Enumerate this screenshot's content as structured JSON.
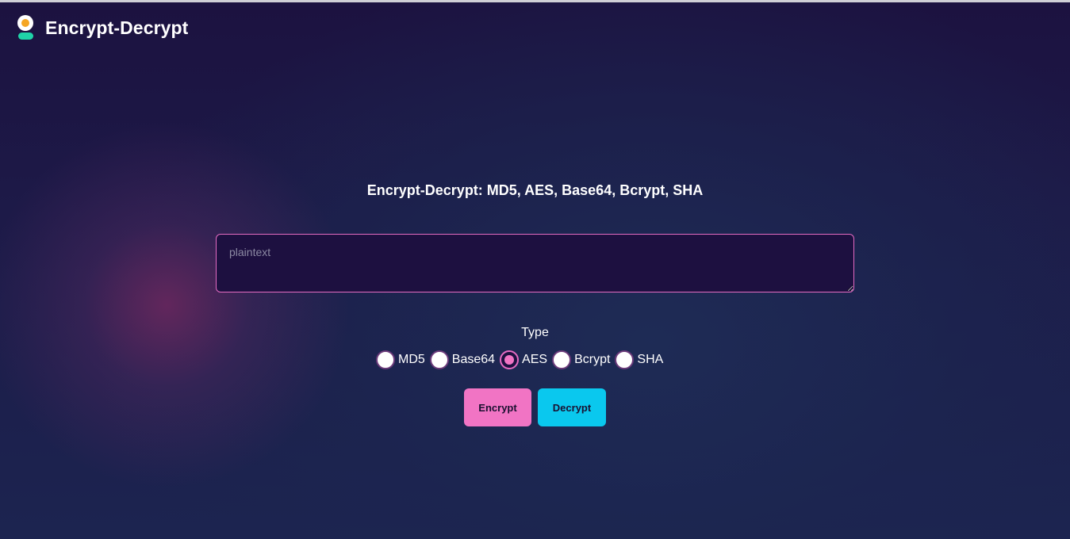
{
  "app": {
    "title": "Encrypt-Decrypt"
  },
  "main": {
    "heading": "Encrypt-Decrypt: MD5, AES, Base64, Bcrypt, SHA",
    "input": {
      "placeholder": "plaintext",
      "value": ""
    },
    "type_label": "Type",
    "types": [
      {
        "label": "MD5",
        "checked": false
      },
      {
        "label": "Base64",
        "checked": false
      },
      {
        "label": "AES",
        "checked": true
      },
      {
        "label": "Bcrypt",
        "checked": false
      },
      {
        "label": "SHA",
        "checked": false
      }
    ],
    "buttons": {
      "encrypt_label": "Encrypt",
      "decrypt_label": "Decrypt"
    }
  },
  "colors": {
    "accent_pink": "#f174c4",
    "accent_cyan": "#0ac8ee",
    "logo_orange": "#f5a623",
    "logo_green": "#1fd3a8"
  },
  "icons": {
    "logo": "user-avatar-logo-icon"
  }
}
